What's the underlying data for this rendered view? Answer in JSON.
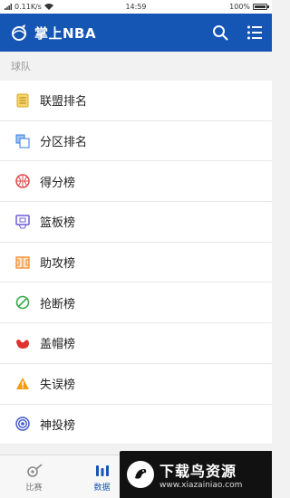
{
  "status_bar": {
    "speed": "0.11K/s",
    "time": "14:59",
    "battery": "100%"
  },
  "app_bar": {
    "title": "掌上NBA",
    "icons": [
      "search-icon",
      "menu-icon"
    ]
  },
  "section": {
    "title": "球队"
  },
  "list": [
    {
      "label": "联盟排名",
      "icon": "standings-icon",
      "color": "#e8c44c"
    },
    {
      "label": "分区排名",
      "icon": "division-icon",
      "color": "#3a7be0"
    },
    {
      "label": "得分榜",
      "icon": "basketball-icon",
      "color": "#e04a4a"
    },
    {
      "label": "篮板榜",
      "icon": "backboard-icon",
      "color": "#6c5bd6"
    },
    {
      "label": "助攻榜",
      "icon": "court-icon",
      "color": "#f08a2b"
    },
    {
      "label": "抢断榜",
      "icon": "no-icon",
      "color": "#3aa84a"
    },
    {
      "label": "盖帽榜",
      "icon": "muscle-icon",
      "color": "#e0312f"
    },
    {
      "label": "失误榜",
      "icon": "warning-icon",
      "color": "#f39c12"
    },
    {
      "label": "神投榜",
      "icon": "target-icon",
      "color": "#3b55c9"
    }
  ],
  "tab_bar": {
    "tabs": [
      {
        "label": "比赛",
        "icon": "whistle-icon",
        "active": false
      },
      {
        "label": "数据",
        "icon": "bar-chart-icon",
        "active": true
      }
    ]
  },
  "watermark": {
    "title": "下载鸟资源",
    "url": "www.xiazainiao.com"
  },
  "colors": {
    "primary": "#1556b5",
    "background": "#f2f2f2"
  }
}
